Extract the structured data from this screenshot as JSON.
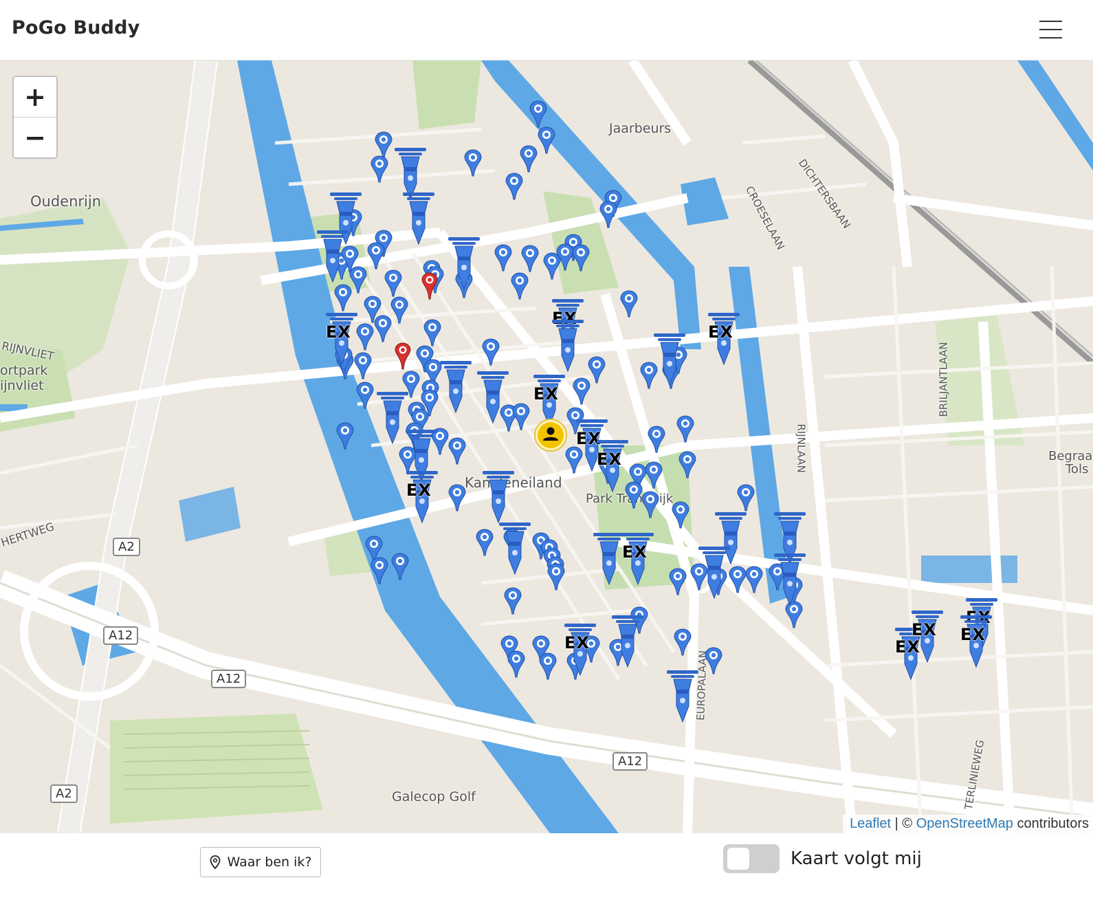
{
  "header": {
    "brand": "PoGo Buddy",
    "menu_icon": "hamburger-menu-icon"
  },
  "map": {
    "zoom_in_label": "+",
    "zoom_out_label": "−",
    "gym_marker_label": "EX",
    "place_labels": {
      "jaarbeurs": "Jaarbeurs",
      "oudenrijn": "Oudenrijn",
      "rijnvliet": "RIJNVLIET",
      "sportpark1": "ortpark",
      "sportpark2": "ijnvliet",
      "hertweg": "HERTWEG",
      "kanaleneiland": "Kanaleneiland",
      "park": "Park Transwijk",
      "galecop": "Galecop Golf",
      "croeselaan": "CROESELAAN",
      "dichtersbaan": "DICHTERSBAAN",
      "briljantlaan": "BRILJANTLAAN",
      "rijnlaan": "RIJNLAAN",
      "europalaan": "EUROPALAAN",
      "sterlinieweg": "TERLINIEWEG",
      "begraaf1": "Begraa",
      "begraaf2": "Tols"
    },
    "road_shields": {
      "a2_top": "A2",
      "a12_left": "A12",
      "a12_mid": "A12",
      "a12_right": "A12",
      "a2_bottom": "A2"
    },
    "attribution": {
      "leaflet": "Leaflet",
      "separator": " | © ",
      "osm": "OpenStreetMap",
      "suffix": " contributors"
    },
    "colors": {
      "pokestop": "#3f7de0",
      "gym": "#2f66c9",
      "red_marker": "#d8312f",
      "user": "#f3c300",
      "water": "#5ea8e6",
      "park": "#c9dfb2",
      "road": "#ffffff"
    }
  },
  "footer": {
    "locate_button": "Waar ben ik?",
    "locate_icon": "location-pin-icon",
    "follow_toggle_label": "Kaart volgt mij",
    "follow_toggle_on": false
  }
}
